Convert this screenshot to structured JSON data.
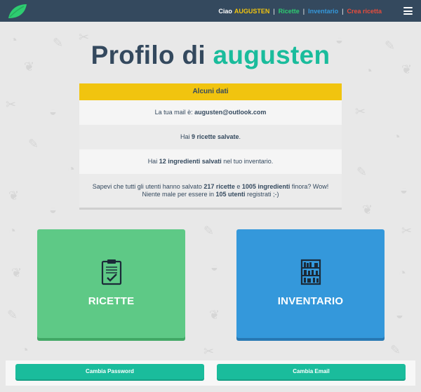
{
  "navbar": {
    "greeting": "Ciao",
    "username": "AUGUSTEN",
    "separator": "|",
    "links": [
      "Ricette",
      "Inventario",
      "Crea ricetta"
    ],
    "menu_icon": "hamburger-icon",
    "logo_icon": "leaf-logo",
    "colors": {
      "bg": "#34495e",
      "user": "#f1c40f",
      "ricette": "#2ecc71",
      "inventario": "#3498db",
      "crea": "#e74c3c"
    }
  },
  "title": {
    "prefix": "Profilo di",
    "username": "augusten"
  },
  "stats": {
    "header": "Alcuni dati",
    "email_pre": "La tua mail è: ",
    "email": "augusten@outlook.com",
    "recipes_pre": "Hai ",
    "recipes_bold": "9 ricette salvate",
    "recipes_post": ".",
    "ingr_pre": "Hai ",
    "ingr_bold": "12 ingredienti salvati",
    "ingr_post": " nel tuo inventario.",
    "global_1": "Sapevi che tutti gli utenti hanno salvato ",
    "global_recipes": "217 ricette",
    "global_2": " e ",
    "global_ingr": "1005 ingredienti",
    "global_3": " finora? Wow!",
    "global_4": "Niente male per essere in ",
    "global_users": "105 utenti",
    "global_5": " registrati ;-)"
  },
  "tiles": {
    "ricette": {
      "label": "RICETTE",
      "icon": "clipboard-check-icon",
      "color": "#5ec986"
    },
    "inventario": {
      "label": "INVENTARIO",
      "icon": "shelves-icon",
      "color": "#3498db"
    }
  },
  "buttons": {
    "password": "Cambia Password",
    "email": "Cambia Email"
  }
}
